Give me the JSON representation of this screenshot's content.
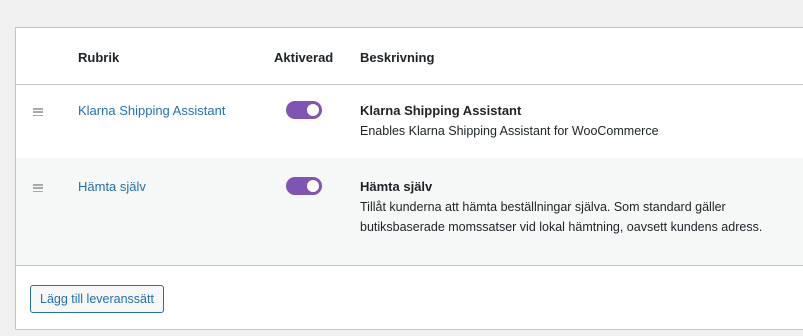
{
  "table": {
    "headers": {
      "title": "Rubrik",
      "enabled": "Aktiverad",
      "description": "Beskrivning"
    },
    "rows": [
      {
        "handle_icon": "drag-handle-icon",
        "title": "Klarna Shipping Assistant",
        "enabled": true,
        "description_title": "Klarna Shipping Assistant",
        "description": "Enables Klarna Shipping Assistant for WooCommerce"
      },
      {
        "handle_icon": "drag-handle-icon",
        "title": "Hämta själv",
        "enabled": true,
        "description_title": "Hämta själv",
        "description": "Tillåt kunderna att hämta beställningar själva. Som standard gäller butiksbaserade momssatser vid lokal hämtning, oavsett kundens adress."
      }
    ]
  },
  "actions": {
    "add_label": "Lägg till leveranssätt"
  },
  "colors": {
    "link": "#2271b1",
    "toggle_on": "#7f54b3",
    "alt_row": "#f6f7f7",
    "page_bg": "#f0f0f1"
  }
}
